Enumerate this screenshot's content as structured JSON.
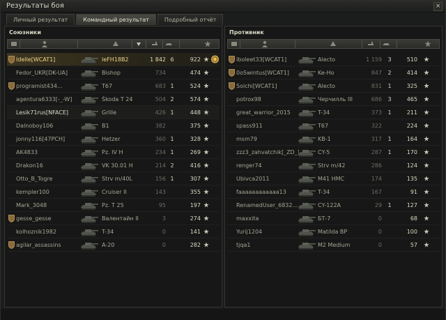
{
  "window": {
    "title": "Результаты боя",
    "close_glyph": "×"
  },
  "tabs": [
    {
      "label": "Личный результат",
      "active": false
    },
    {
      "label": "Командный результат",
      "active": true
    },
    {
      "label": "Подробный отчёт",
      "active": false
    }
  ],
  "allies": {
    "title": "Союзники",
    "rows": [
      {
        "platoon": true,
        "player": "Idelle[WCAT1]",
        "vehicle": "leFH18B2",
        "damage": "1 842",
        "frags": "6",
        "xp": "922",
        "self": true,
        "medal": true
      },
      {
        "platoon": false,
        "player": "Fedor_UKR[DK-UA]",
        "vehicle": "Bishop",
        "damage": "734",
        "frags": "",
        "xp": "474"
      },
      {
        "platoon": true,
        "player": "programist434...",
        "vehicle": "T67",
        "damage": "683",
        "frags": "1",
        "xp": "524"
      },
      {
        "platoon": false,
        "player": "agentura6333[-_-W]",
        "vehicle": "Škoda T 24",
        "damage": "504",
        "frags": "2",
        "xp": "574"
      },
      {
        "platoon": false,
        "player": "Lesik71rus[NFACE]",
        "vehicle": "Grille",
        "damage": "426",
        "frags": "1",
        "xp": "448",
        "bright": true
      },
      {
        "platoon": false,
        "player": "Dalnoboy106",
        "vehicle": "B1",
        "damage": "382",
        "frags": "",
        "xp": "375"
      },
      {
        "platoon": false,
        "player": "jonny116[47PCH]",
        "vehicle": "Hetzer",
        "damage": "360",
        "frags": "1",
        "xp": "328"
      },
      {
        "platoon": false,
        "player": "AK4833",
        "vehicle": "Pz. IV H",
        "damage": "234",
        "frags": "1",
        "xp": "269"
      },
      {
        "platoon": false,
        "player": "Drakon16",
        "vehicle": "VK 30.01 H",
        "damage": "214",
        "frags": "2",
        "xp": "416"
      },
      {
        "platoon": false,
        "player": "Otto_B_Togre",
        "vehicle": "Strv m/40L",
        "damage": "156",
        "frags": "1",
        "xp": "307"
      },
      {
        "platoon": false,
        "player": "kempler100",
        "vehicle": "Cruiser II",
        "damage": "143",
        "frags": "",
        "xp": "355"
      },
      {
        "platoon": false,
        "player": "Mark_3048",
        "vehicle": "Pz. T 25",
        "damage": "95",
        "frags": "",
        "xp": "197"
      },
      {
        "platoon": true,
        "player": "gesse_gesse",
        "vehicle": "Валентайн II",
        "damage": "3",
        "frags": "",
        "xp": "274"
      },
      {
        "platoon": false,
        "player": "kolhoznik1982",
        "vehicle": "T-34",
        "damage": "0",
        "frags": "",
        "xp": "141"
      },
      {
        "platoon": true,
        "player": "agilar_assassins",
        "vehicle": "A-20",
        "damage": "0",
        "frags": "",
        "xp": "282"
      }
    ]
  },
  "enemies": {
    "title": "Противник",
    "rows": [
      {
        "platoon": true,
        "player": "Iboleet33[WCAT1]",
        "vehicle": "Alecto",
        "damage": "1 159",
        "frags": "3",
        "xp": "510"
      },
      {
        "platoon": true,
        "player": "0oSwintus[WCAT1]",
        "vehicle": "Ke-Ho",
        "damage": "847",
        "frags": "2",
        "xp": "414"
      },
      {
        "platoon": true,
        "player": "Soichi[WCAT1]",
        "vehicle": "Alecto",
        "damage": "831",
        "frags": "1",
        "xp": "325"
      },
      {
        "platoon": false,
        "player": "potrox98",
        "vehicle": "Черчилль III",
        "damage": "686",
        "frags": "3",
        "xp": "465"
      },
      {
        "platoon": false,
        "player": "great_warrior_2015",
        "vehicle": "T-34",
        "damage": "373",
        "frags": "1",
        "xp": "211"
      },
      {
        "platoon": false,
        "player": "spass911",
        "vehicle": "T67",
        "damage": "322",
        "frags": "",
        "xp": "224"
      },
      {
        "platoon": false,
        "player": "msm79",
        "vehicle": "KB-1",
        "damage": "317",
        "frags": "1",
        "xp": "164"
      },
      {
        "platoon": false,
        "player": "zzz3_zahvatchik[_ZD_]",
        "vehicle": "CY-5",
        "damage": "287",
        "frags": "1",
        "xp": "170"
      },
      {
        "platoon": false,
        "player": "renger74",
        "vehicle": "Strv m/42",
        "damage": "286",
        "frags": "",
        "xp": "124"
      },
      {
        "platoon": false,
        "player": "Ubivca2011",
        "vehicle": "M41 HMC",
        "damage": "174",
        "frags": "",
        "xp": "135"
      },
      {
        "platoon": false,
        "player": "faaaaaaaaaaaa13",
        "vehicle": "T-34",
        "damage": "167",
        "frags": "",
        "xp": "91"
      },
      {
        "platoon": false,
        "player": "RenamedUser_6832...",
        "vehicle": "CY-122A",
        "damage": "29",
        "frags": "1",
        "xp": "127"
      },
      {
        "platoon": false,
        "player": "maxxita",
        "vehicle": "БТ-7",
        "damage": "0",
        "frags": "",
        "xp": "68"
      },
      {
        "platoon": false,
        "player": "Yurij1204",
        "vehicle": "Matilda BP",
        "damage": "0",
        "frags": "",
        "xp": "100"
      },
      {
        "platoon": false,
        "player": "tjqa1",
        "vehicle": "M2 Medium",
        "damage": "0",
        "frags": "",
        "xp": "57"
      }
    ]
  },
  "colors": {
    "highlight": "#f0d68a",
    "text": "#b7b5a7",
    "accent_tab": "#484943"
  }
}
